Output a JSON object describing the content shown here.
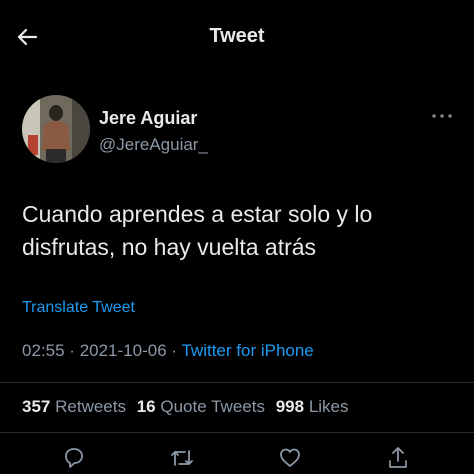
{
  "header": {
    "title": "Tweet",
    "back_icon": "arrow-left-icon"
  },
  "author": {
    "name": "Jere Aguiar",
    "handle": "@JereAguiar_",
    "more_icon": "more-dots-icon"
  },
  "tweet": {
    "text": "Cuando aprendes a estar solo y lo disfrutas, no hay vuelta atrás",
    "translate_label": "Translate Tweet",
    "time": "02:55",
    "date": "2021-10-06",
    "separator": "·",
    "source": "Twitter for iPhone"
  },
  "stats": {
    "retweets_count": "357",
    "retweets_label": "Retweets",
    "quote_count": "16",
    "quote_label": "Quote Tweets",
    "likes_count": "998",
    "likes_label": "Likes"
  },
  "actions": [
    "reply-icon",
    "retweet-icon",
    "like-icon",
    "share-icon"
  ],
  "colors": {
    "background": "#000000",
    "text": "#e7e9ea",
    "muted": "#8b98a5",
    "accent": "#1d9bf0"
  }
}
